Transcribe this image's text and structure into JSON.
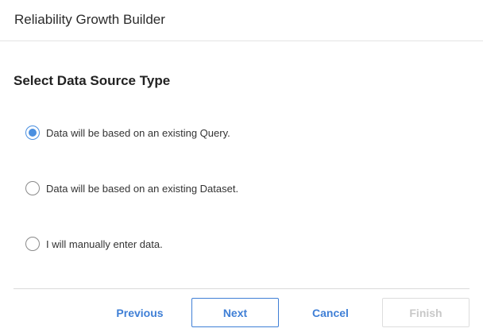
{
  "dialog": {
    "title": "Reliability Growth Builder"
  },
  "section": {
    "title": "Select Data Source Type"
  },
  "options": [
    {
      "label": "Data will be based on an existing Query.",
      "checked": true
    },
    {
      "label": "Data will be based on an existing Dataset.",
      "checked": false
    },
    {
      "label": "I will manually enter data.",
      "checked": false
    }
  ],
  "footer": {
    "previous_label": "Previous",
    "next_label": "Next",
    "cancel_label": "Cancel",
    "finish_label": "Finish",
    "finish_enabled": false
  },
  "colors": {
    "accent": "#3f7fd6",
    "radio_selected": "#4a8fe0",
    "disabled_text": "#c8c8c8"
  }
}
